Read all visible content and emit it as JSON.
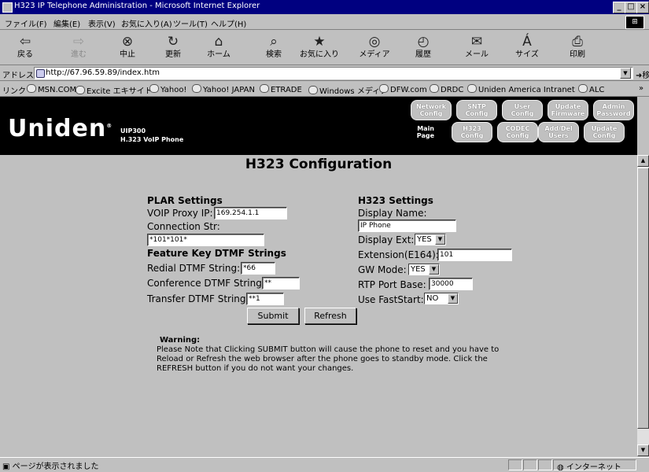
{
  "window": {
    "title": "H323 IP Telephone Administration - Microsoft Internet Explorer",
    "controls": [
      "_",
      "□",
      "×"
    ]
  },
  "menu": [
    "ファイル(F)",
    "編集(E)",
    "表示(V)",
    "お気に入り(A)",
    "ツール(T)",
    "ヘルプ(H)"
  ],
  "toolbar": [
    {
      "label": "戻る",
      "icon": "back-arrow-icon",
      "glyph": "⇦"
    },
    {
      "label": "進む",
      "icon": "forward-arrow-icon",
      "glyph": "⇨"
    },
    {
      "label": "中止",
      "icon": "stop-icon",
      "glyph": "⊗"
    },
    {
      "label": "更新",
      "icon": "refresh-icon",
      "glyph": "↻"
    },
    {
      "label": "ホーム",
      "icon": "home-icon",
      "glyph": "⌂"
    },
    {
      "label": "検索",
      "icon": "search-icon",
      "glyph": "⌕"
    },
    {
      "label": "お気に入り",
      "icon": "favorites-icon",
      "glyph": "★"
    },
    {
      "label": "メディア",
      "icon": "media-icon",
      "glyph": "◎"
    },
    {
      "label": "履歴",
      "icon": "history-icon",
      "glyph": "◴"
    },
    {
      "label": "メール",
      "icon": "mail-icon",
      "glyph": "✉"
    },
    {
      "label": "サイズ",
      "icon": "font-size-icon",
      "glyph": "Á"
    },
    {
      "label": "印刷",
      "icon": "print-icon",
      "glyph": "⎙"
    }
  ],
  "address": {
    "label": "アドレス(D)",
    "url": "http://67.96.59.89/index.htm",
    "go_label": "移動"
  },
  "links": {
    "label": "リンク",
    "items": [
      "MSN.COM",
      "Excite エキサイト",
      "Yahoo!",
      "Yahoo! JAPAN",
      "ETRADE",
      "Windows メディア",
      "DFW.com",
      "DRDC",
      "Uniden America Intranet",
      "ALC"
    ]
  },
  "banner": {
    "brand": "Uniden",
    "model_line1": "UIP300",
    "model_line2": "H.323 VoIP Phone",
    "main_page_label": "Main Page",
    "nav_row1": [
      "Network Config",
      "SNTP Config",
      "User Config",
      "Update Firmware",
      "Admin Password"
    ],
    "nav_row2": [
      "H323 Config",
      "CODEC Config",
      "Add/Del Users",
      "Update Config"
    ]
  },
  "page": {
    "title": "H323 Configuration",
    "plar": {
      "heading": "PLAR Settings",
      "voip_proxy_label": "VOIP Proxy IP:",
      "voip_proxy_value": "169.254.1.1",
      "connection_label": "Connection Str:",
      "connection_value": "*101*101*"
    },
    "dtmf": {
      "heading": "Feature Key DTMF Strings",
      "redial_label": "Redial DTMF String:",
      "redial_value": "*66",
      "conference_label": "Conference DTMF String:",
      "conference_value": "**",
      "transfer_label": "Transfer DTMF String:",
      "transfer_value": "**1"
    },
    "h323": {
      "heading": "H323 Settings",
      "display_name_label": "Display Name:",
      "display_name_value": "IP Phone",
      "display_ext_label": "Display Ext:",
      "display_ext_value": "YES",
      "extension_label": "Extension(E164):",
      "extension_value": "101",
      "gw_mode_label": "GW Mode:",
      "gw_mode_value": "YES",
      "rtp_label": "RTP Port Base:",
      "rtp_value": "30000",
      "faststart_label": "Use FastStart:",
      "faststart_value": "NO"
    },
    "submit_label": "Submit",
    "refresh_label": "Refresh",
    "warning_title": "Warning:",
    "warning_text": "Please Note that Clicking SUBMIT button will cause the phone to reset and you have to Reload or Refresh the web browser after the phone goes to standby mode. Click the REFRESH button if you do not want your changes."
  },
  "status": {
    "text": "ページが表示されました",
    "zone": "インターネット"
  }
}
